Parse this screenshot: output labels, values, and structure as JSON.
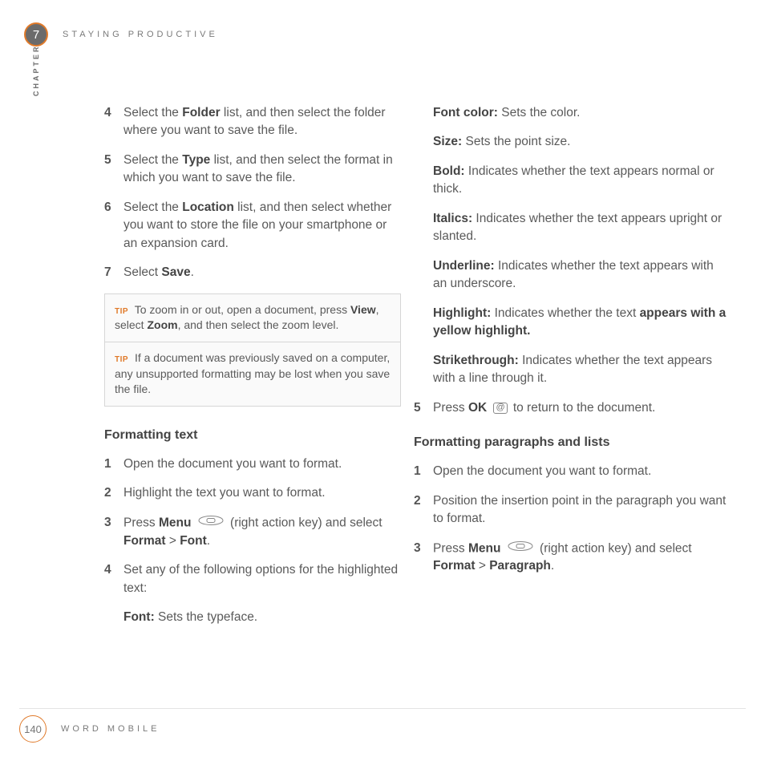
{
  "header": {
    "chapter_number": "7",
    "chapter_title": "STAYING PRODUCTIVE",
    "side_label": "CHAPTER"
  },
  "left": {
    "steps_upper": [
      {
        "n": "4",
        "pre": "Select the ",
        "b1": "Folder",
        "post": " list, and then select the folder where you want to save the file."
      },
      {
        "n": "5",
        "pre": "Select the ",
        "b1": "Type",
        "post": " list, and then select the format in which you want to save the file."
      },
      {
        "n": "6",
        "pre": "Select the ",
        "b1": "Location",
        "post": " list, and then select whether you want to store the file on your smartphone or an expansion card."
      },
      {
        "n": "7",
        "pre": "Select ",
        "b1": "Save",
        "post": "."
      }
    ],
    "tips": [
      {
        "label": "TIP",
        "pre": "To zoom in or out, open a document, press ",
        "b1": "View",
        "mid": ", select ",
        "b2": "Zoom",
        "post": ", and then select the zoom level."
      },
      {
        "label": "TIP",
        "pre": "If a document was previously saved on a computer, any unsupported formatting may be lost when you save the file.",
        "b1": "",
        "mid": "",
        "b2": "",
        "post": ""
      }
    ],
    "section_head": "Formatting text",
    "steps_lower": [
      {
        "n": "1",
        "text": "Open the document you want to format."
      },
      {
        "n": "2",
        "text": "Highlight the text you want to format."
      },
      {
        "n": "3",
        "pre": "Press ",
        "b1": "Menu",
        "mid": " (right action key) and select ",
        "b2": "Format",
        "sep": " > ",
        "b3": "Font",
        "post": "."
      },
      {
        "n": "4",
        "text": "Set any of the following options for the highlighted text:"
      }
    ],
    "font_def": {
      "term": "Font:",
      "desc": " Sets the typeface."
    }
  },
  "right": {
    "defs": [
      {
        "term": "Font color:",
        "desc": " Sets the color."
      },
      {
        "term": "Size:",
        "desc": " Sets the point size."
      },
      {
        "term": "Bold:",
        "desc": " Indicates whether the text appears normal or thick."
      },
      {
        "term": "Italics:",
        "desc": " Indicates whether the text appears upright or slanted."
      },
      {
        "term": "Underline:",
        "desc": " Indicates whether the text appears with an underscore."
      },
      {
        "term": "Highlight:",
        "desc_pre": " Indicates whether the text ",
        "desc_bold": "appears with a yellow highlight."
      },
      {
        "term": "Strikethrough:",
        "desc": " Indicates whether the text appears with a line through it."
      }
    ],
    "step5": {
      "n": "5",
      "pre": "Press ",
      "b1": "OK",
      "post": " to return to the document."
    },
    "section_head": "Formatting paragraphs and lists",
    "steps": [
      {
        "n": "1",
        "text": "Open the document you want to format."
      },
      {
        "n": "2",
        "text": "Position the insertion point in the paragraph you want to format."
      },
      {
        "n": "3",
        "pre": "Press ",
        "b1": "Menu",
        "mid": " (right action key) and select ",
        "b2": "Format",
        "sep": " > ",
        "b3": "Paragraph",
        "post": "."
      }
    ]
  },
  "footer": {
    "page": "140",
    "title": "WORD MOBILE"
  }
}
